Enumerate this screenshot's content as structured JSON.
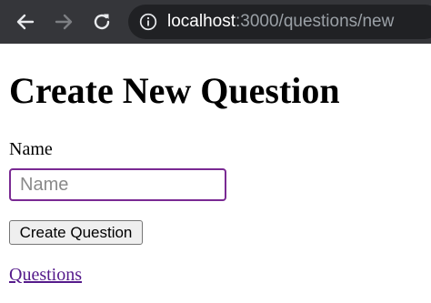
{
  "browser": {
    "url_host": "localhost",
    "url_path": ":3000/questions/new",
    "icons": {
      "back": "arrow-left-icon",
      "forward": "arrow-right-icon",
      "reload": "reload-icon",
      "site_info": "info-icon"
    },
    "colors": {
      "toolbar": "#35363a",
      "omnibox": "#202124",
      "url_host": "#ffffff",
      "url_path": "#9aa0a6"
    }
  },
  "page": {
    "title": "Create New Question",
    "form": {
      "name_label": "Name",
      "name_value": "",
      "name_placeholder": "Name",
      "submit_label": "Create Question"
    },
    "link_label": "Questions",
    "colors": {
      "input_focus_border": "#7a2a93",
      "visited_link": "#551a8b"
    }
  }
}
